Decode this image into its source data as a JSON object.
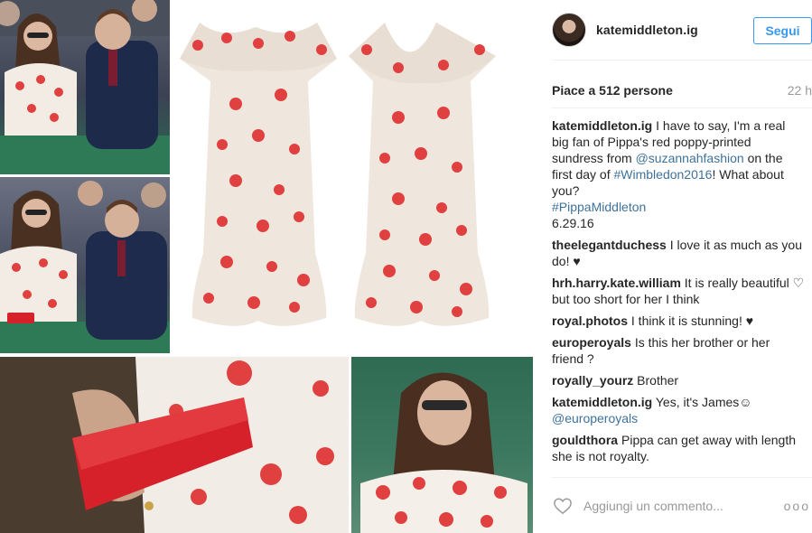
{
  "post": {
    "username": "katemiddleton.ig",
    "follow_label": "Segui",
    "likes_label": "Piace a 512 persone",
    "time_label": "22 h",
    "caption": {
      "username": "katemiddleton.ig",
      "text_1": "I have to say, I'm a real big fan of Pippa's red poppy-printed sundress from",
      "mention": "@suzannahfashion",
      "text_2": "on the first day of",
      "hashtag_1": "#Wimbledon2016",
      "text_3": "! What about you?",
      "hashtag_2": "#PippaMiddleton",
      "date": "6.29.16"
    },
    "comments": [
      {
        "username": "theelegantduchess",
        "text": "I love it as much as you do! ♥"
      },
      {
        "username": "hrh.harry.kate.william",
        "text": "It is really beautiful ♡ but too short for her I think"
      },
      {
        "username": "royal.photos",
        "text": "I think it is stunning! ♥"
      },
      {
        "username": "europeroyals",
        "text": "Is this her brother or her friend ?"
      },
      {
        "username": "royally_yourz",
        "text": "Brother"
      },
      {
        "username": "katemiddleton.ig",
        "text": "Yes, it's James☺",
        "mention": "@europeroyals"
      },
      {
        "username": "gouldthora",
        "text": "Pippa can get away with length she is not royalty."
      }
    ],
    "add_comment_placeholder": "Aggiungi un commento...",
    "more_label": "ooo"
  },
  "icons": {
    "like": "heart-outline-icon",
    "more": "more-options-icon",
    "avatar": "profile-avatar"
  },
  "colors": {
    "accent": "#3897f0",
    "link": "#3f729b",
    "muted": "#999999",
    "text": "#262626",
    "poppy_red": "#e0403f",
    "dress_cream": "#efe7de"
  }
}
